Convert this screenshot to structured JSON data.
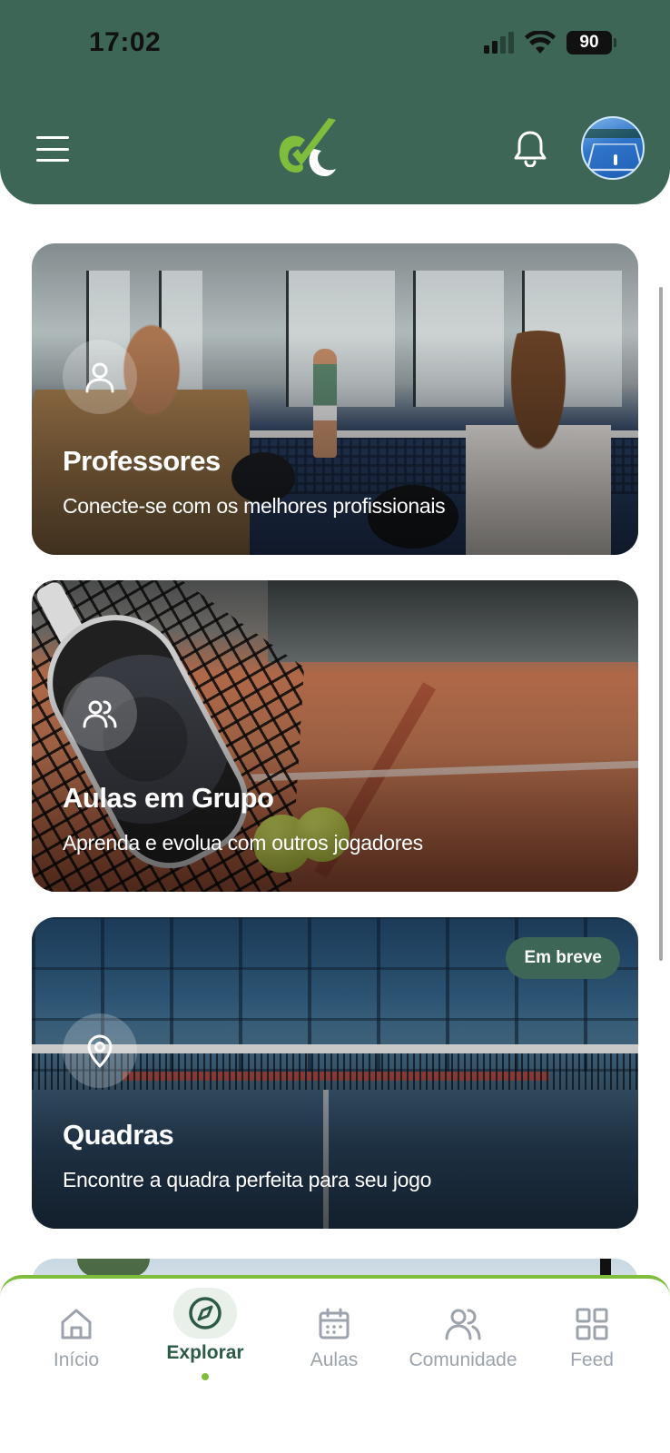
{
  "status_bar": {
    "time": "17:02",
    "battery": "90"
  },
  "header": {
    "menu_icon": "hamburger-menu-icon",
    "logo": "app-logo-checkmark",
    "notification_icon": "bell-icon",
    "colors": {
      "header_bg": "#3d6656",
      "logo_green": "#7fbd3d"
    }
  },
  "cards": [
    {
      "icon": "user-icon",
      "title": "Professores",
      "subtitle": "Conecte-se com os melhores profissionais"
    },
    {
      "icon": "users-icon",
      "title": "Aulas em Grupo",
      "subtitle": "Aprenda e evolua com outros jogadores"
    },
    {
      "icon": "map-pin-icon",
      "title": "Quadras",
      "subtitle": "Encontre a quadra perfeita para seu jogo",
      "badge": "Em breve"
    }
  ],
  "bottom_nav": {
    "items": [
      {
        "label": "Início",
        "icon": "home-icon"
      },
      {
        "label": "Explorar",
        "icon": "compass-icon",
        "active": true
      },
      {
        "label": "Aulas",
        "icon": "calendar-icon"
      },
      {
        "label": "Comunidade",
        "icon": "users-icon"
      },
      {
        "label": "Feed",
        "icon": "grid-icon"
      }
    ],
    "colors": {
      "active": "#2d5a47",
      "inactive": "#9ca3ad",
      "accent": "#7fbd3d"
    }
  }
}
